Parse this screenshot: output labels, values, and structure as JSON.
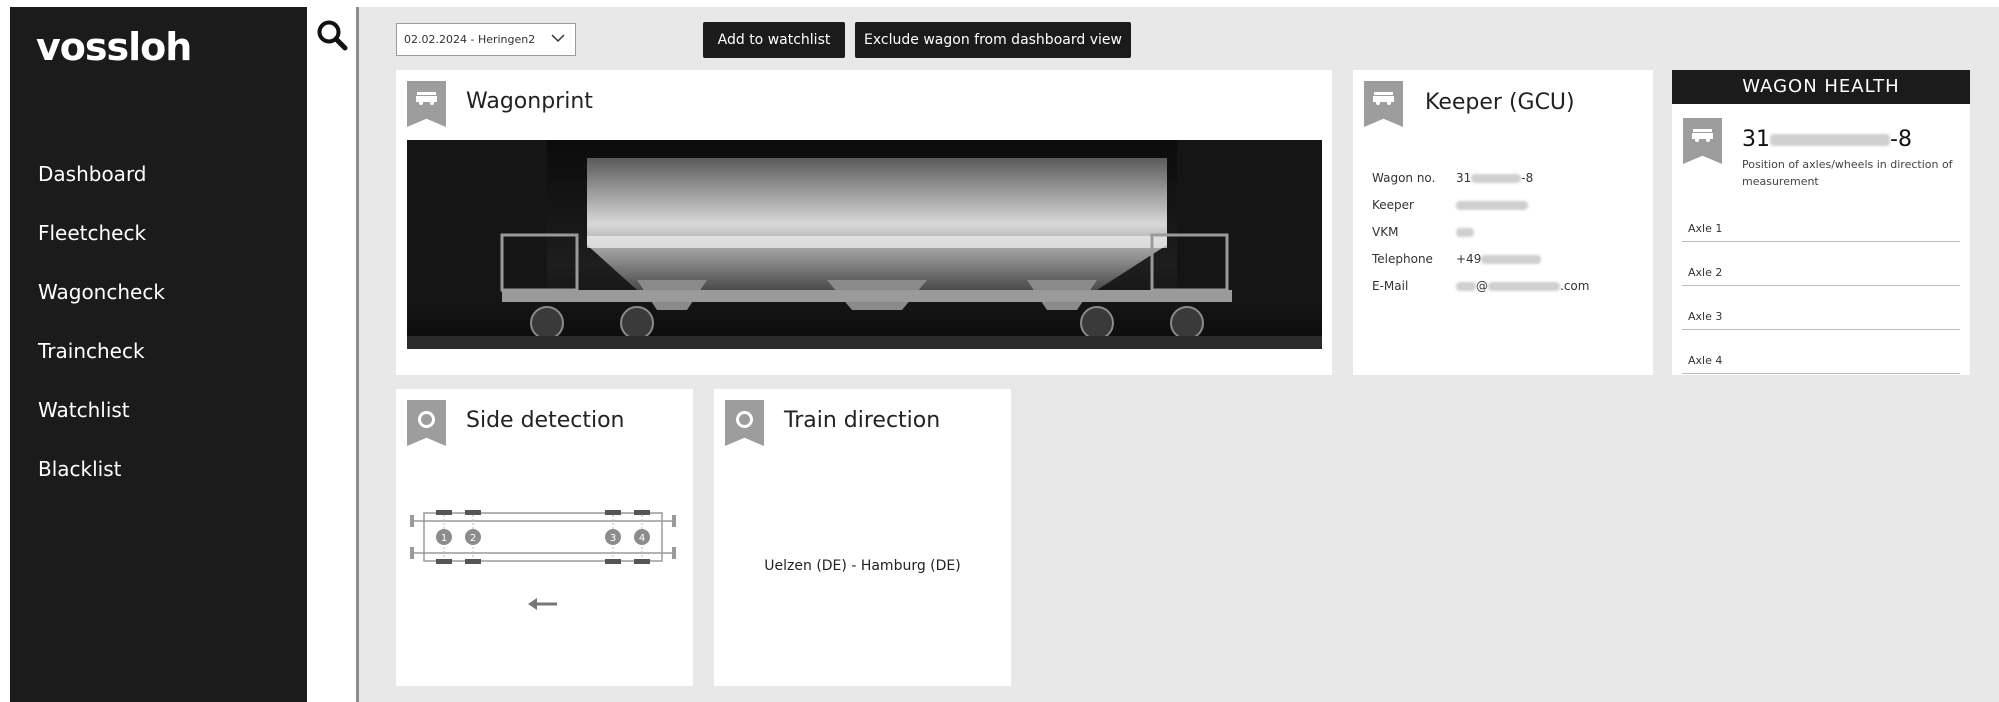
{
  "brand": {
    "logo_text": "vossloh",
    "accent": "#7fc242"
  },
  "sidebar": {
    "items": [
      {
        "label": "Dashboard"
      },
      {
        "label": "Fleetcheck"
      },
      {
        "label": "Wagoncheck",
        "active": true
      },
      {
        "label": "Traincheck"
      },
      {
        "label": "Watchlist"
      },
      {
        "label": "Blacklist"
      }
    ]
  },
  "toolbar": {
    "measurement_select": "02.02.2024 - Heringen2",
    "add_watchlist_label": "Add to watchlist",
    "exclude_label": "Exclude wagon from dashboard view"
  },
  "wagonprint": {
    "title": "Wagonprint"
  },
  "keeper": {
    "title": "Keeper (GCU)",
    "rows": [
      {
        "key": "Wagon no.",
        "value_prefix": "31",
        "value_suffix": "-8"
      },
      {
        "key": "Keeper",
        "value_prefix": "",
        "value_suffix": ""
      },
      {
        "key": "VKM",
        "value_prefix": "",
        "value_suffix": ""
      },
      {
        "key": "Telephone",
        "value_prefix": "+49",
        "value_suffix": ""
      },
      {
        "key": "E-Mail",
        "value_prefix": "",
        "value_suffix": "@",
        "value_end": ".com"
      }
    ]
  },
  "health": {
    "header": "WAGON HEALTH",
    "wagon_prefix": "31",
    "wagon_suffix": "-8",
    "subtitle": "Position of axles/wheels in direction of measurement",
    "axles": [
      "Axle 1",
      "Axle 2",
      "Axle 3",
      "Axle 4"
    ]
  },
  "side_detection": {
    "title": "Side detection",
    "wheel_labels": [
      "1",
      "2",
      "3",
      "4"
    ]
  },
  "train_direction": {
    "title": "Train direction",
    "route": "Uelzen (DE) - Hamburg (DE)"
  }
}
